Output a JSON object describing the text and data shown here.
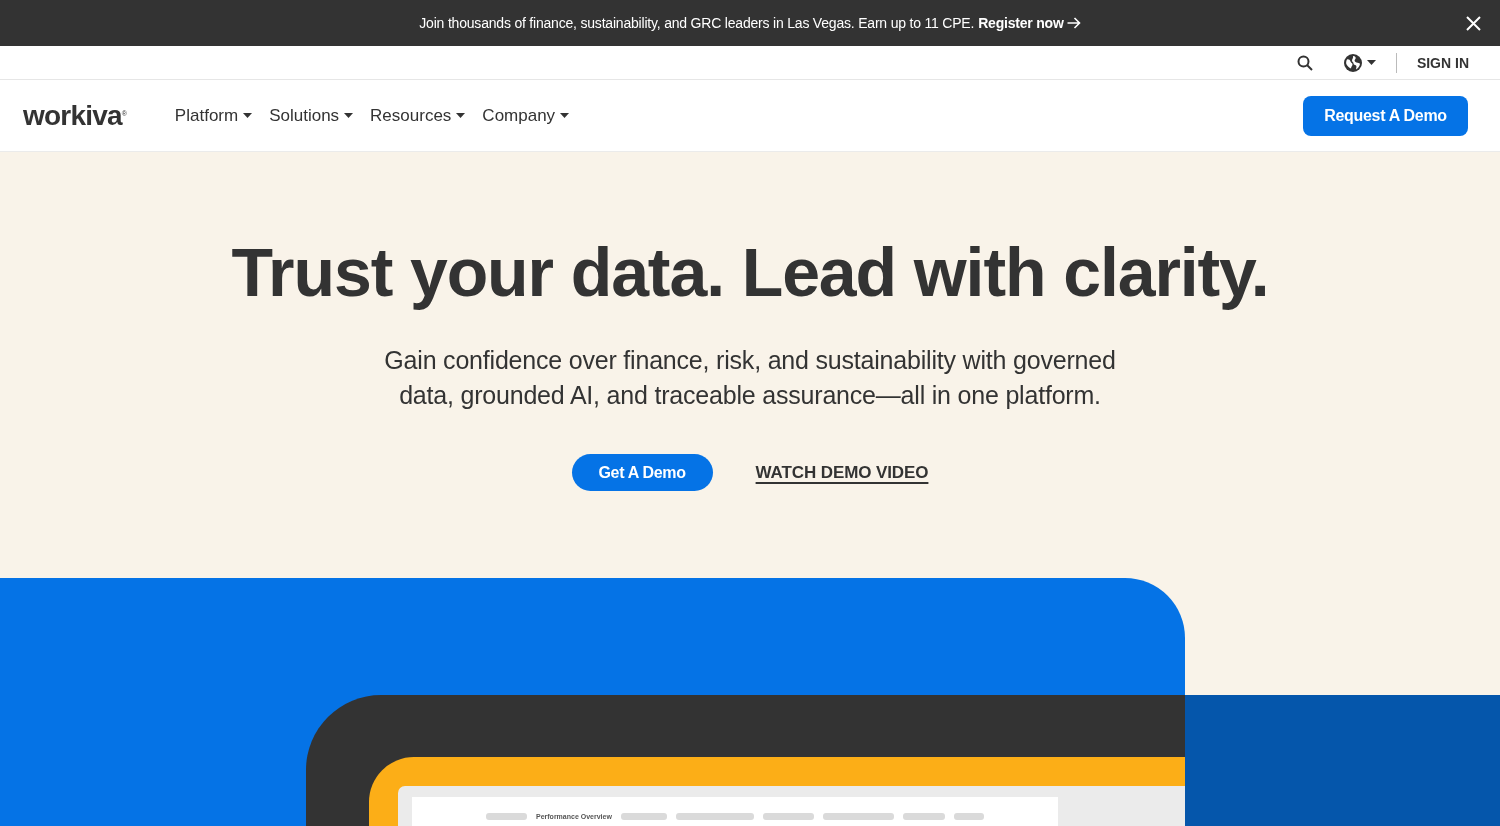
{
  "announcement": {
    "text": "Join thousands of finance, sustainability, and GRC leaders in Las Vegas. Earn up to 11 CPE.",
    "link": "Register now"
  },
  "utility_nav": {
    "sign_in": "SIGN IN"
  },
  "header": {
    "logo": {
      "text": "workiva",
      "mark": "®"
    },
    "menu": [
      "Platform",
      "Solutions",
      "Resources",
      "Company"
    ],
    "cta": "Request A Demo"
  },
  "hero": {
    "title": "Trust your data. Lead with clarity.",
    "subtitle": "Gain confidence over finance, risk, and sustainability with governed data, grounded AI, and traceable assurance—all in one platform.",
    "primary_button": "Get A Demo",
    "video_link": "WATCH DEMO VIDEO"
  },
  "app_preview": {
    "tab_label": "Performance Overview"
  }
}
